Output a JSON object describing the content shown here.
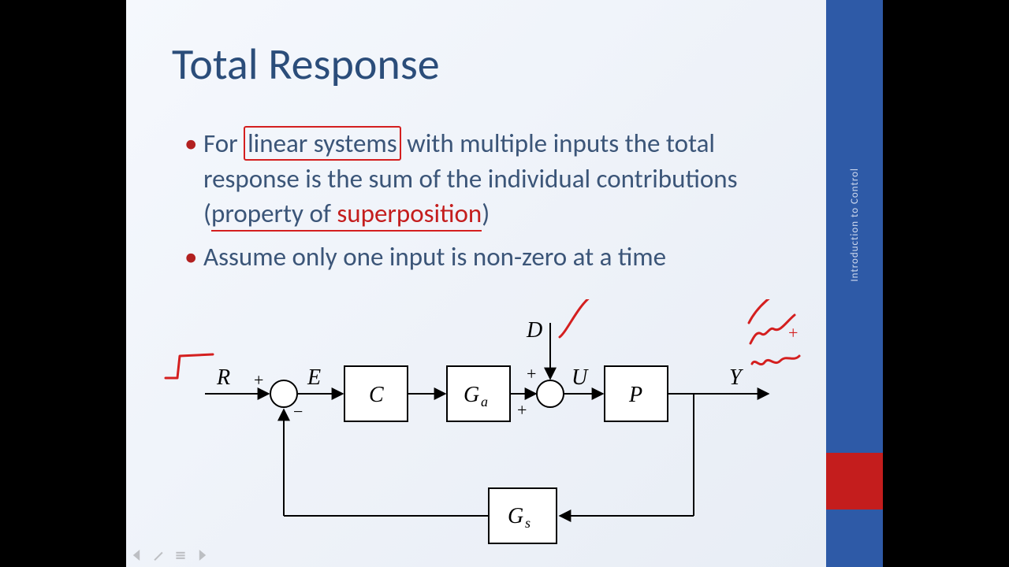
{
  "sidebar_label": "Introduction to Control",
  "title": "Total Response",
  "bullet1": {
    "pre": "For ",
    "boxed": "linear systems",
    "mid": " with multiple inputs the total response is the sum of the individual contributions (",
    "prop": "property of ",
    "super": "superposition",
    "post": ")"
  },
  "bullet2": "Assume only one input is non-zero at a time",
  "diagram": {
    "R": "R",
    "E": "E",
    "C": "C",
    "Ga_main": "G",
    "Ga_sub": "a",
    "D": "D",
    "U": "U",
    "P": "P",
    "Y": "Y",
    "Gs_main": "G",
    "Gs_sub": "s",
    "plus": "+",
    "minus": "−"
  }
}
